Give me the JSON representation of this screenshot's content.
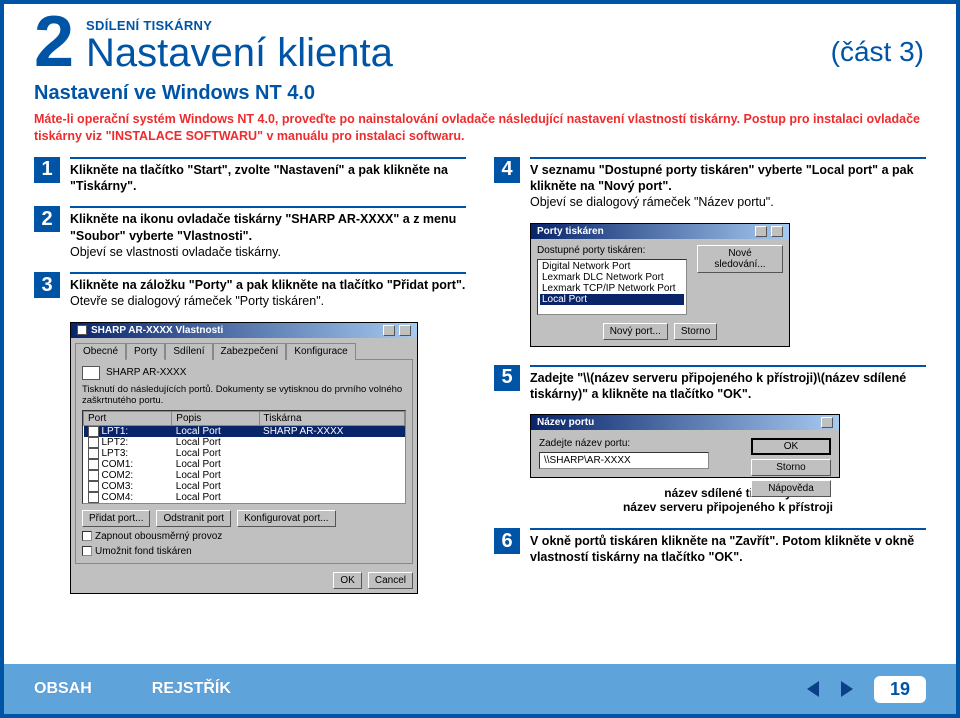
{
  "header": {
    "chapter_num": "2",
    "eyebrow": "SDÍLENÍ TISKÁRNY",
    "title": "Nastavení klienta",
    "part": "(část 3)",
    "subtitle": "Nastavení ve Windows NT 4.0",
    "intro": "Máte-li operační systém Windows NT 4.0, proveďte po nainstalování ovladače následující nastavení vlastností tiskárny. Postup pro instalaci ovladače tiskárny viz \"INSTALACE SOFTWARU\" v manuálu pro instalaci softwaru."
  },
  "steps": {
    "s1": {
      "num": "1",
      "bold": "Klikněte na tlačítko \"Start\", zvolte \"Nastavení\" a pak klikněte na \"Tiskárny\"."
    },
    "s2": {
      "num": "2",
      "bold": "Klikněte na ikonu ovladače tiskárny \"SHARP AR-XXXX\" a z menu \"Soubor\" vyberte \"Vlastnosti\".",
      "plain": "Objeví se vlastnosti ovladače tiskárny."
    },
    "s3": {
      "num": "3",
      "bold": "Klikněte na záložku \"Porty\" a pak klikněte na tlačítko \"Přidat port\".",
      "plain": "Otevře se dialogový rámeček \"Porty tiskáren\"."
    },
    "s4": {
      "num": "4",
      "bold": "V seznamu \"Dostupné porty tiskáren\" vyberte \"Local port\" a pak klikněte na \"Nový port\".",
      "plain": "Objeví se dialogový rámeček \"Název portu\"."
    },
    "s5": {
      "num": "5",
      "bold": "Zadejte \"\\\\(název serveru připojeného k přístroji)\\(název sdílené tiskárny)\" a klikněte na tlačítko \"OK\"."
    },
    "s6": {
      "num": "6",
      "bold": "V okně portů tiskáren klikněte na \"Zavřít\". Potom klikněte v okně vlastností tiskárny na tlačítko \"OK\"."
    }
  },
  "mock1": {
    "title": "SHARP AR-XXXX Vlastnosti",
    "tabs": {
      "t1": "Obecné",
      "t2": "Porty",
      "t3": "Sdílení",
      "t4": "Zabezpečení",
      "t5": "Konfigurace"
    },
    "printer_name": "SHARP AR-XXXX",
    "desc": "Tisknutí do následujících portů. Dokumenty se vytisknou do prvního volného zaškrtnutého portu.",
    "cols": {
      "c1": "Port",
      "c2": "Popis",
      "c3": "Tiskárna"
    },
    "rows": [
      {
        "port": "LPT1:",
        "desc": "Local Port",
        "printer": "SHARP AR-XXXX",
        "sel": true
      },
      {
        "port": "LPT2:",
        "desc": "Local Port",
        "printer": ""
      },
      {
        "port": "LPT3:",
        "desc": "Local Port",
        "printer": ""
      },
      {
        "port": "COM1:",
        "desc": "Local Port",
        "printer": ""
      },
      {
        "port": "COM2:",
        "desc": "Local Port",
        "printer": ""
      },
      {
        "port": "COM3:",
        "desc": "Local Port",
        "printer": ""
      },
      {
        "port": "COM4:",
        "desc": "Local Port",
        "printer": ""
      }
    ],
    "btns": {
      "add": "Přidat port...",
      "del": "Odstranit port",
      "conf": "Konfigurovat port..."
    },
    "chk1": "Zapnout obousměrný provoz",
    "chk2": "Umožnit fond tiskáren",
    "ok": "OK",
    "cancel": "Cancel"
  },
  "mock2": {
    "title": "Porty tiskáren",
    "label": "Dostupné porty tiskáren:",
    "items": [
      "Digital Network Port",
      "Lexmark DLC Network Port",
      "Lexmark TCP/IP Network Port",
      "Local Port"
    ],
    "btn_new_watch": "Nové sledování...",
    "btn_new_port": "Nový port...",
    "btn_close": "Storno"
  },
  "mock3": {
    "title": "Název portu",
    "label": "Zadejte název portu:",
    "value": "\\\\SHARP\\AR-XXXX",
    "ok": "OK",
    "cancel": "Storno",
    "help": "Nápověda",
    "cap1": "název sdílené tiskárny",
    "cap2": "název serveru připojeného k přístroji"
  },
  "footer": {
    "contents": "OBSAH",
    "index": "REJSTŘÍK",
    "page": "19"
  }
}
